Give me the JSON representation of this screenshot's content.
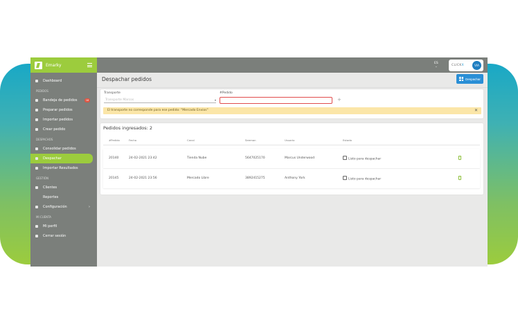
{
  "app": {
    "brand": "Emarky"
  },
  "sidebar": {
    "items": [
      {
        "type": "item",
        "label": "Dashboard",
        "name": "sidebar-item-dashboard"
      },
      {
        "type": "section",
        "label": "PEDIDOS",
        "name": "sidebar-section-pedidos"
      },
      {
        "type": "item",
        "label": "Bandeja de pedidos",
        "badge": "18",
        "name": "sidebar-item-bandeja-de-pedidos"
      },
      {
        "type": "item",
        "label": "Preparar pedidos",
        "name": "sidebar-item-preparar-pedidos"
      },
      {
        "type": "item",
        "label": "Importar pedidos",
        "name": "sidebar-item-importar-pedidos"
      },
      {
        "type": "item",
        "label": "Crear pedido",
        "name": "sidebar-item-crear-pedido"
      },
      {
        "type": "section",
        "label": "DESPACHOS",
        "name": "sidebar-section-despachos"
      },
      {
        "type": "item",
        "label": "Consolidar pedidos",
        "name": "sidebar-item-consolidar-pedidos"
      },
      {
        "type": "item",
        "label": "Despachar",
        "active": true,
        "name": "sidebar-item-despachar"
      },
      {
        "type": "item",
        "label": "Importar Resultados",
        "name": "sidebar-item-importar-resultados"
      },
      {
        "type": "section",
        "label": "GESTIÓN",
        "name": "sidebar-section-gestion"
      },
      {
        "type": "item",
        "label": "Clientes",
        "name": "sidebar-item-clientes"
      },
      {
        "type": "item",
        "label": "Reportes",
        "noicon": true,
        "name": "sidebar-item-reportes"
      },
      {
        "type": "item",
        "label": "Configuración",
        "chevron": "›",
        "name": "sidebar-item-configuracion"
      },
      {
        "type": "section",
        "label": "MI CUENTA",
        "name": "sidebar-section-mi-cuenta"
      },
      {
        "type": "item",
        "label": "Mi perfil",
        "name": "sidebar-item-mi-perfil"
      },
      {
        "type": "item",
        "label": "Cerrar sesión",
        "name": "sidebar-item-cerrar-sesion"
      }
    ]
  },
  "topbar": {
    "lang": "ES",
    "lang_chevron": "⌄",
    "clickx_prefix": "CLICK",
    "clickx_suffix": "X",
    "clickx_badge": "VIA"
  },
  "page": {
    "title": "Despachar pedidos",
    "despachar_button": "Despachar"
  },
  "form": {
    "transporte_label": "Transporte",
    "transporte_placeholder": "Transporte Marcos",
    "transporte_caret": "▾",
    "pedido_label": "#Pedido",
    "pedido_value": "",
    "plus": "+",
    "alert_text": "El transporte no corresponde para ese pedido: \"Mercado Envios\"",
    "alert_close": "✕"
  },
  "table": {
    "title": "Pedidos ingresados: 2",
    "columns": [
      "#Pedido",
      "Fecha",
      "Canal",
      "Seeman",
      "Usuario",
      "Estado"
    ],
    "rows": [
      {
        "pedido": "20140",
        "fecha": "24-02-2021 23:42",
        "canal": "Tienda Nube",
        "seeman": "5647025170",
        "usuario": "Marcus Underwood",
        "estado": "Listo para despachar"
      },
      {
        "pedido": "20145",
        "fecha": "24-02-2021 23:56",
        "canal": "Mercado Libre",
        "seeman": "3892415275",
        "usuario": "Anthony York",
        "estado": "Listo para despachar"
      }
    ]
  },
  "colors": {
    "accent_green": "#9ccc3d",
    "sidebar_gray": "#7b7f7b",
    "button_blue": "#2a8fd6",
    "alert_yellow": "#fbe6a8",
    "error_red": "#e04b4b"
  }
}
